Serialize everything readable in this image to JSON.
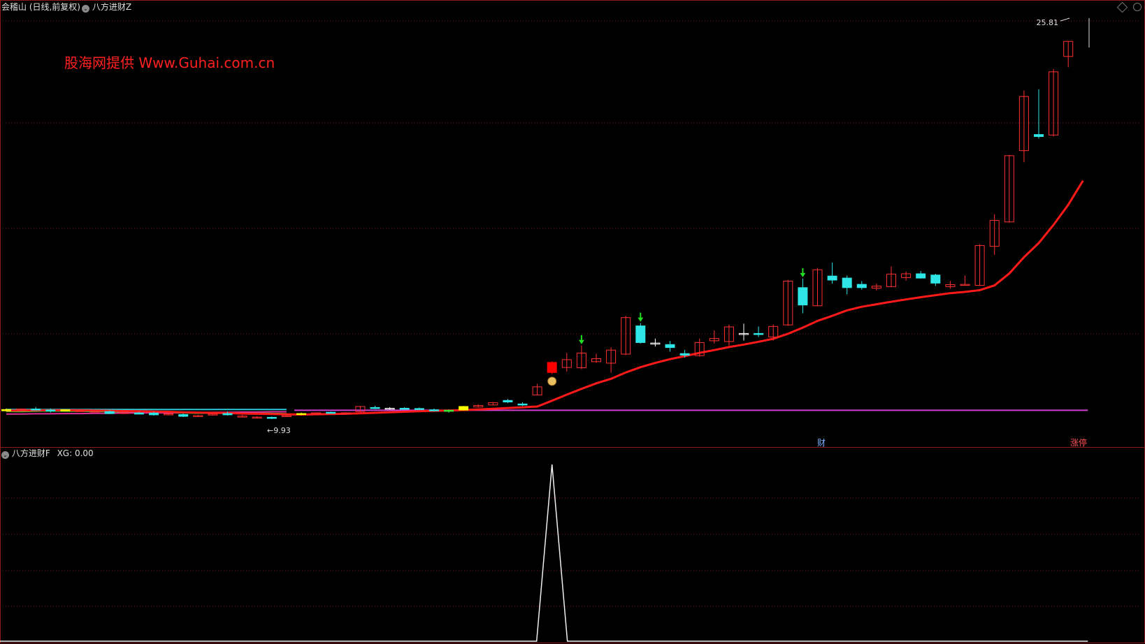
{
  "header": {
    "title": "会稽山 (日线,前复权)",
    "indicator_main": "八方进财Z",
    "indicator_sub": "八方进财F",
    "xg_label": "XG: 0.00"
  },
  "watermark": "股海网提供  Www.Guhai.com.cn",
  "colors": {
    "up": "#ff3030",
    "down": "#2fe6e6",
    "flat": "#ffffff",
    "ma": "#ff1a1a",
    "support": "#d040d0",
    "bottom_green": "#39e639",
    "bottom_cyan": "#2ec8d8",
    "bottom_pink": "#e0309a",
    "signal_yellow": "#ffff00",
    "grid": "#7a1a1a",
    "border": "#8c1c1c"
  },
  "chart_data": [
    {
      "type": "candlestick",
      "price_range": [
        9.2,
        25.9
      ],
      "high_label": "25.81",
      "low_label": "9.93",
      "support_level": 10.35,
      "annotations": [
        "财",
        "涨停"
      ],
      "candles": [
        {
          "o": 10.38,
          "h": 10.42,
          "l": 10.3,
          "c": 10.33,
          "k": "y"
        },
        {
          "o": 10.4,
          "h": 10.42,
          "l": 10.32,
          "c": 10.34,
          "k": "r"
        },
        {
          "o": 10.4,
          "h": 10.48,
          "l": 10.35,
          "c": 10.36,
          "k": "d"
        },
        {
          "o": 10.36,
          "h": 10.42,
          "l": 10.26,
          "c": 10.34,
          "k": "d"
        },
        {
          "o": 10.37,
          "h": 10.39,
          "l": 10.33,
          "c": 10.34,
          "k": "y"
        },
        {
          "o": 10.34,
          "h": 10.37,
          "l": 10.3,
          "c": 10.34,
          "k": "r"
        },
        {
          "o": 10.32,
          "h": 10.35,
          "l": 10.28,
          "c": 10.3,
          "k": "r"
        },
        {
          "o": 10.3,
          "h": 10.34,
          "l": 10.2,
          "c": 10.22,
          "k": "d"
        },
        {
          "o": 10.28,
          "h": 10.31,
          "l": 10.2,
          "c": 10.22,
          "k": "r"
        },
        {
          "o": 10.24,
          "h": 10.29,
          "l": 10.22,
          "c": 10.24,
          "k": "d"
        },
        {
          "o": 10.24,
          "h": 10.29,
          "l": 10.14,
          "c": 10.17,
          "k": "d"
        },
        {
          "o": 10.2,
          "h": 10.24,
          "l": 10.15,
          "c": 10.21,
          "k": "r"
        },
        {
          "o": 10.18,
          "h": 10.22,
          "l": 10.08,
          "c": 10.11,
          "k": "d"
        },
        {
          "o": 10.14,
          "h": 10.17,
          "l": 10.08,
          "c": 10.1,
          "k": "r"
        },
        {
          "o": 10.2,
          "h": 10.23,
          "l": 10.16,
          "c": 10.19,
          "k": "r"
        },
        {
          "o": 10.22,
          "h": 10.3,
          "l": 10.14,
          "c": 10.17,
          "k": "d"
        },
        {
          "o": 10.12,
          "h": 10.16,
          "l": 10.08,
          "c": 10.09,
          "k": "r"
        },
        {
          "o": 10.08,
          "h": 10.11,
          "l": 10.03,
          "c": 10.05,
          "k": "r"
        },
        {
          "o": 10.07,
          "h": 10.1,
          "l": 10.0,
          "c": 10.03,
          "k": "d"
        },
        {
          "o": 10.14,
          "h": 10.17,
          "l": 10.1,
          "c": 10.12,
          "k": "r"
        },
        {
          "o": 10.22,
          "h": 10.26,
          "l": 10.15,
          "c": 10.18,
          "k": "y"
        },
        {
          "o": 10.21,
          "h": 10.26,
          "l": 10.2,
          "c": 10.25,
          "k": "r"
        },
        {
          "o": 10.26,
          "h": 10.3,
          "l": 10.23,
          "c": 10.27,
          "k": "d"
        },
        {
          "o": 10.23,
          "h": 10.27,
          "l": 10.21,
          "c": 10.25,
          "k": "r"
        },
        {
          "o": 10.3,
          "h": 10.52,
          "l": 10.28,
          "c": 10.5,
          "k": "r"
        },
        {
          "o": 10.46,
          "h": 10.53,
          "l": 10.4,
          "c": 10.44,
          "k": "d"
        },
        {
          "o": 10.43,
          "h": 10.47,
          "l": 10.4,
          "c": 10.43,
          "k": "f"
        },
        {
          "o": 10.43,
          "h": 10.47,
          "l": 10.39,
          "c": 10.42,
          "k": "d"
        },
        {
          "o": 10.42,
          "h": 10.46,
          "l": 10.37,
          "c": 10.4,
          "k": "d"
        },
        {
          "o": 10.37,
          "h": 10.42,
          "l": 10.31,
          "c": 10.35,
          "k": "d"
        },
        {
          "o": 10.35,
          "h": 10.38,
          "l": 10.25,
          "c": 10.33,
          "k": "g"
        },
        {
          "o": 10.36,
          "h": 10.52,
          "l": 10.34,
          "c": 10.5,
          "k": "y"
        },
        {
          "o": 10.48,
          "h": 10.58,
          "l": 10.46,
          "c": 10.54,
          "k": "r"
        },
        {
          "o": 10.56,
          "h": 10.68,
          "l": 10.54,
          "c": 10.65,
          "k": "r"
        },
        {
          "o": 10.74,
          "h": 10.8,
          "l": 10.64,
          "c": 10.68,
          "k": "d"
        },
        {
          "o": 10.57,
          "h": 10.67,
          "l": 10.52,
          "c": 10.6,
          "k": "d"
        },
        {
          "o": 10.96,
          "h": 11.4,
          "l": 10.94,
          "c": 11.28,
          "k": "r"
        },
        {
          "o": 11.85,
          "h": 12.3,
          "l": 11.78,
          "c": 12.25,
          "k": "R"
        },
        {
          "o": 12.05,
          "h": 12.62,
          "l": 11.88,
          "c": 12.36,
          "k": "r"
        },
        {
          "o": 12.04,
          "h": 12.92,
          "l": 11.98,
          "c": 12.62,
          "k": "r"
        },
        {
          "o": 12.28,
          "h": 12.6,
          "l": 12.24,
          "c": 12.4,
          "k": "r"
        },
        {
          "o": 12.22,
          "h": 12.85,
          "l": 11.84,
          "c": 12.74,
          "k": "r"
        },
        {
          "o": 12.58,
          "h": 14.1,
          "l": 12.54,
          "c": 14.03,
          "k": "r"
        },
        {
          "o": 13.7,
          "h": 13.81,
          "l": 13.0,
          "c": 13.04,
          "k": "d"
        },
        {
          "o": 13.0,
          "h": 13.2,
          "l": 12.88,
          "c": 13.02,
          "k": "f"
        },
        {
          "o": 12.96,
          "h": 13.1,
          "l": 12.68,
          "c": 12.84,
          "k": "d"
        },
        {
          "o": 12.6,
          "h": 12.75,
          "l": 12.44,
          "c": 12.54,
          "k": "d"
        },
        {
          "o": 12.52,
          "h": 13.2,
          "l": 12.48,
          "c": 13.04,
          "k": "r"
        },
        {
          "o": 13.11,
          "h": 13.52,
          "l": 13.0,
          "c": 13.2,
          "k": "r"
        },
        {
          "o": 13.08,
          "h": 13.75,
          "l": 12.92,
          "c": 13.66,
          "k": "r"
        },
        {
          "o": 13.4,
          "h": 13.79,
          "l": 13.12,
          "c": 13.4,
          "k": "f"
        },
        {
          "o": 13.4,
          "h": 13.68,
          "l": 13.26,
          "c": 13.36,
          "k": "d"
        },
        {
          "o": 13.26,
          "h": 13.76,
          "l": 13.12,
          "c": 13.68,
          "k": "r"
        },
        {
          "o": 13.74,
          "h": 15.53,
          "l": 13.7,
          "c": 15.48,
          "k": "r"
        },
        {
          "o": 15.22,
          "h": 15.58,
          "l": 14.2,
          "c": 14.53,
          "k": "d"
        },
        {
          "o": 14.5,
          "h": 16.0,
          "l": 14.48,
          "c": 15.93,
          "k": "r"
        },
        {
          "o": 15.68,
          "h": 16.22,
          "l": 15.38,
          "c": 15.52,
          "k": "d"
        },
        {
          "o": 15.6,
          "h": 15.7,
          "l": 14.95,
          "c": 15.22,
          "k": "d"
        },
        {
          "o": 15.35,
          "h": 15.48,
          "l": 15.14,
          "c": 15.22,
          "k": "d"
        },
        {
          "o": 15.2,
          "h": 15.38,
          "l": 15.1,
          "c": 15.28,
          "k": "r"
        },
        {
          "o": 15.26,
          "h": 16.06,
          "l": 15.24,
          "c": 15.76,
          "k": "r"
        },
        {
          "o": 15.62,
          "h": 15.86,
          "l": 15.5,
          "c": 15.77,
          "k": "r"
        },
        {
          "o": 15.77,
          "h": 15.88,
          "l": 15.58,
          "c": 15.6,
          "k": "d"
        },
        {
          "o": 15.72,
          "h": 15.77,
          "l": 15.29,
          "c": 15.4,
          "k": "d"
        },
        {
          "o": 15.26,
          "h": 15.48,
          "l": 15.18,
          "c": 15.34,
          "k": "r"
        },
        {
          "o": 15.31,
          "h": 15.7,
          "l": 15.3,
          "c": 15.35,
          "k": "r"
        },
        {
          "o": 15.31,
          "h": 16.95,
          "l": 15.29,
          "c": 16.89,
          "k": "r"
        },
        {
          "o": 16.86,
          "h": 18.14,
          "l": 16.52,
          "c": 17.89,
          "k": "r"
        },
        {
          "o": 17.83,
          "h": 20.49,
          "l": 17.8,
          "c": 20.46,
          "k": "r"
        },
        {
          "o": 20.66,
          "h": 23.05,
          "l": 20.2,
          "c": 22.81,
          "k": "r"
        },
        {
          "o": 21.3,
          "h": 23.1,
          "l": 21.14,
          "c": 21.22,
          "k": "d"
        },
        {
          "o": 21.28,
          "h": 23.9,
          "l": 21.22,
          "c": 23.79,
          "k": "r"
        },
        {
          "o": 24.4,
          "h": 25.0,
          "l": 23.97,
          "c": 25.0,
          "k": "r"
        }
      ],
      "ma": [
        10.34,
        10.34,
        10.35,
        10.35,
        10.35,
        10.35,
        10.34,
        10.33,
        10.32,
        10.31,
        10.3,
        10.29,
        10.27,
        10.26,
        10.25,
        10.24,
        10.22,
        10.21,
        10.2,
        10.19,
        10.18,
        10.19,
        10.2,
        10.21,
        10.23,
        10.25,
        10.27,
        10.29,
        10.31,
        10.33,
        10.34,
        10.36,
        10.38,
        10.41,
        10.44,
        10.47,
        10.5,
        10.73,
        10.97,
        11.2,
        11.42,
        11.6,
        11.85,
        12.06,
        12.23,
        12.38,
        12.5,
        12.63,
        12.74,
        12.86,
        12.96,
        13.07,
        13.19,
        13.39,
        13.63,
        13.9,
        14.1,
        14.32,
        14.46,
        14.56,
        14.66,
        14.75,
        14.84,
        14.92,
        15.0,
        15.05,
        15.12,
        15.31,
        15.78,
        16.43,
        16.99,
        17.71,
        18.51,
        19.47
      ],
      "bottom_lines": {
        "green": [
          10.32,
          10.31,
          10.33,
          10.34,
          10.33,
          10.33,
          10.32,
          10.31,
          10.3,
          10.29,
          10.28,
          10.27,
          10.26,
          10.25,
          10.25,
          10.24,
          10.23,
          10.22,
          10.21,
          10.2
        ],
        "cyan": [
          10.38,
          10.38,
          10.38,
          10.38,
          10.38,
          10.38,
          10.38,
          10.38,
          10.38,
          10.38,
          10.38,
          10.38,
          10.38,
          10.38,
          10.38,
          10.38,
          10.38,
          10.38,
          10.38,
          10.38
        ],
        "pink": [
          10.2,
          10.2,
          10.21,
          10.21,
          10.22,
          10.22,
          10.23,
          10.23,
          10.24,
          10.24,
          10.25,
          10.25,
          10.26,
          10.26,
          10.27,
          10.27,
          10.28,
          10.28,
          10.29,
          10.29
        ]
      },
      "down_arrows": [
        39,
        43,
        54
      ]
    },
    {
      "type": "line",
      "series_name": "XG",
      "x_index": 37,
      "values": [
        0,
        1
      ],
      "ylim": [
        0,
        1
      ]
    }
  ]
}
